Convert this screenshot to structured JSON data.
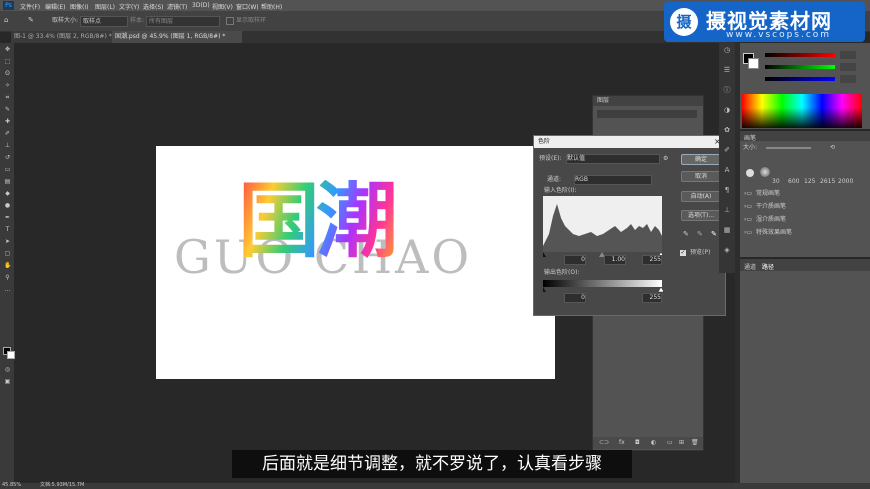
{
  "menubar": {
    "items": [
      "文件(F)",
      "编辑(E)",
      "图像(I)",
      "图层(L)",
      "文字(Y)",
      "选择(S)",
      "滤镜(T)",
      "3D(D)",
      "视图(V)",
      "窗口(W)",
      "帮助(H)"
    ]
  },
  "optionsbar": {
    "sample_size_label": "取样大小:",
    "sample_size_value": "取样点",
    "sample_label": "样本:",
    "sample_value": "所有图层",
    "show_ring_label": "显示取样环"
  },
  "tabs": [
    {
      "label": "图-1 @ 33.4% (图层 2, RGB/8#) *"
    },
    {
      "label": "国潮.psd @ 45.9% (图层 1, RGB/8#) *"
    }
  ],
  "canvas": {
    "bg_text": "GUO CHAO",
    "art_text": "国潮"
  },
  "levels": {
    "title": "色阶",
    "preset_label": "预设(E):",
    "preset_value": "默认值",
    "channel_label": "通道:",
    "channel_value": "RGB",
    "input_label": "输入色阶(I):",
    "input_black": "0",
    "input_gamma": "1.00",
    "input_white": "255",
    "output_label": "输出色阶(O):",
    "output_black": "0",
    "output_white": "255",
    "ok": "确定",
    "cancel": "取消",
    "auto": "自动(A)",
    "options": "选项(T)...",
    "preview": "预览(P)",
    "preview_checked": true
  },
  "layers_panel": {
    "tab": "图层"
  },
  "brush_panel": {
    "tab": "画笔",
    "size_label": "大小:",
    "presets": [
      "30",
      "600",
      "125",
      "2615",
      "2000"
    ],
    "groups": [
      "常规画笔",
      "干介质画笔",
      "湿介质画笔",
      "特殊效果画笔"
    ]
  },
  "paths_panel": {
    "tabs": [
      "通道",
      "路径"
    ]
  },
  "status": {
    "zoom": "45.85%",
    "doc": "文档:5.93M/15.7M"
  },
  "subtitle": "后面就是细节调整，就不罗说了，认真看步骤",
  "watermark": {
    "text": "摄视觉素材网",
    "url": "www.vscops.com",
    "logo_char": "摄"
  }
}
